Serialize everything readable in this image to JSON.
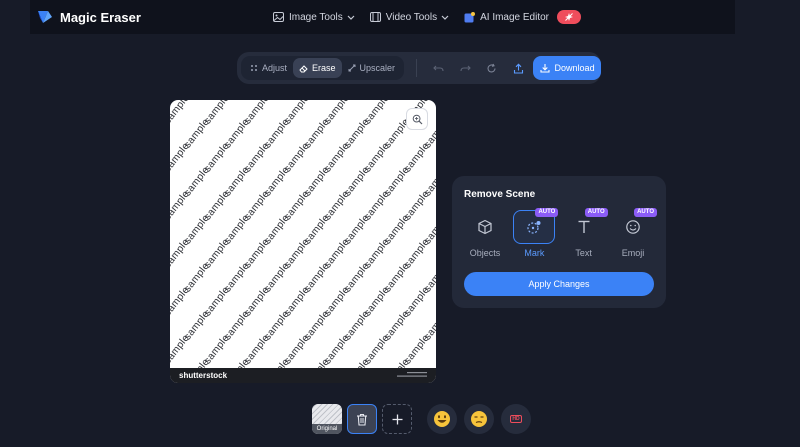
{
  "app": {
    "name": "Magic Eraser"
  },
  "nav": {
    "items": [
      {
        "label": "Image Tools",
        "icon": "image-icon"
      },
      {
        "label": "Video Tools",
        "icon": "film-icon"
      },
      {
        "label": "AI Image Editor",
        "icon": "ai-editor-icon"
      }
    ]
  },
  "toolbar": {
    "modes": [
      {
        "label": "Adjust",
        "icon": "grid-icon"
      },
      {
        "label": "Erase",
        "icon": "eraser-icon"
      },
      {
        "label": "Upscaler",
        "icon": "expand-icon"
      }
    ],
    "active_mode": "Erase",
    "download_label": "Download"
  },
  "canvas": {
    "watermark_text": "sample",
    "footer_logo": "shutterstock"
  },
  "panel": {
    "title": "Remove Scene",
    "options": [
      {
        "label": "Objects",
        "icon": "cube-icon",
        "auto": ""
      },
      {
        "label": "Mark",
        "icon": "mark-icon",
        "auto": "AUTO"
      },
      {
        "label": "Text",
        "icon": "text-icon",
        "auto": "AUTO"
      },
      {
        "label": "Emoji",
        "icon": "smile-icon",
        "auto": "AUTO"
      }
    ],
    "selected": "Mark",
    "apply_label": "Apply Changes"
  },
  "tray": {
    "thumbnail_label": "Original",
    "hd_badge": "HD"
  },
  "colors": {
    "background": "#171b28",
    "accent": "#3b82f6",
    "auto_badge": "#8b5cf6",
    "hot_badge": "#ef4d5c"
  }
}
